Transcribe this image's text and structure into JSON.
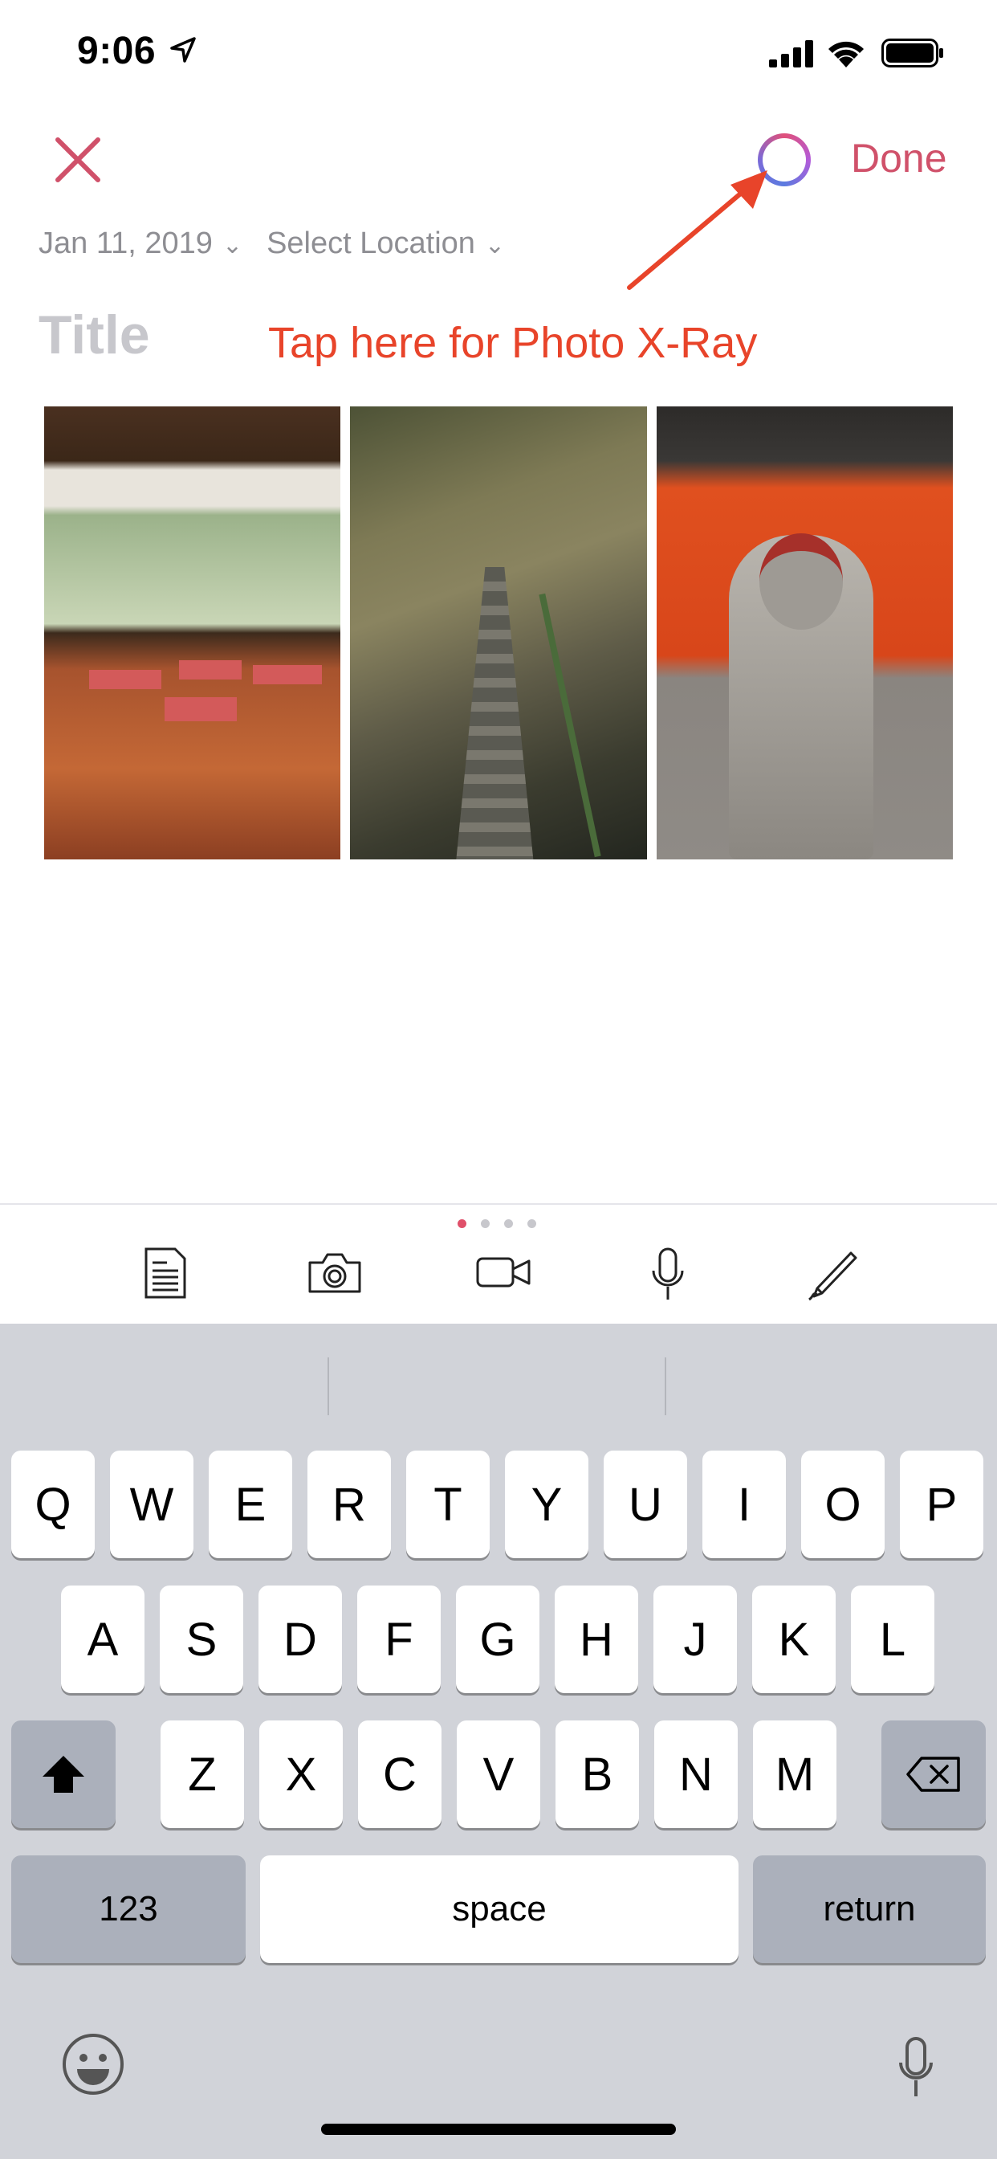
{
  "status_bar": {
    "time": "9:06"
  },
  "header": {
    "done_label": "Done"
  },
  "meta": {
    "date": "Jan 11, 2019",
    "location": "Select Location"
  },
  "title_placeholder": "Title",
  "annotation": "Tap here for Photo X-Ray",
  "photos": [
    "photo-interior-room",
    "photo-stone-stairs",
    "photo-stone-statue"
  ],
  "toolbar": {
    "icons": [
      "document-icon",
      "camera-icon",
      "video-icon",
      "microphone-icon",
      "pencil-icon"
    ],
    "page_count": 4,
    "active_page": 0
  },
  "keyboard": {
    "row1": [
      "Q",
      "W",
      "E",
      "R",
      "T",
      "Y",
      "U",
      "I",
      "O",
      "P"
    ],
    "row2": [
      "A",
      "S",
      "D",
      "F",
      "G",
      "H",
      "J",
      "K",
      "L"
    ],
    "row3": [
      "Z",
      "X",
      "C",
      "V",
      "B",
      "N",
      "M"
    ],
    "numbers_label": "123",
    "space_label": "space",
    "return_label": "return"
  },
  "colors": {
    "accent": "#d0516a",
    "annotation": "#e8442a",
    "keyboard_bg": "#d1d3d9"
  }
}
